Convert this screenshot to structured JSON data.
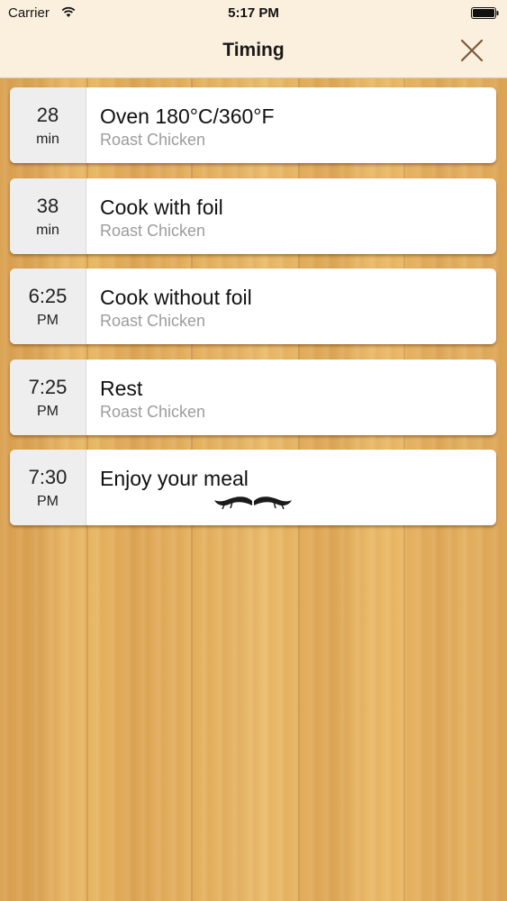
{
  "status_bar": {
    "carrier": "Carrier",
    "time": "5:17 PM"
  },
  "nav": {
    "title": "Timing",
    "close_icon": "close-x-icon"
  },
  "colors": {
    "nav_background": "#fbf0dd",
    "card_time_background": "#eeeeee",
    "subtitle_gray": "#9c9c9c",
    "wood": "#e2ab58"
  },
  "steps": [
    {
      "time": "28",
      "unit": "min",
      "title": "Oven 180°C/360°F",
      "subtitle": "Roast Chicken"
    },
    {
      "time": "38",
      "unit": "min",
      "title": "Cook with foil",
      "subtitle": "Roast Chicken"
    },
    {
      "time": "6:25",
      "unit": "PM",
      "title": "Cook without foil",
      "subtitle": "Roast Chicken"
    },
    {
      "time": "7:25",
      "unit": "PM",
      "title": "Rest",
      "subtitle": "Roast Chicken"
    },
    {
      "time": "7:30",
      "unit": "PM",
      "title": "Enjoy your meal",
      "subtitle": "",
      "icon": "mustache-icon"
    }
  ]
}
